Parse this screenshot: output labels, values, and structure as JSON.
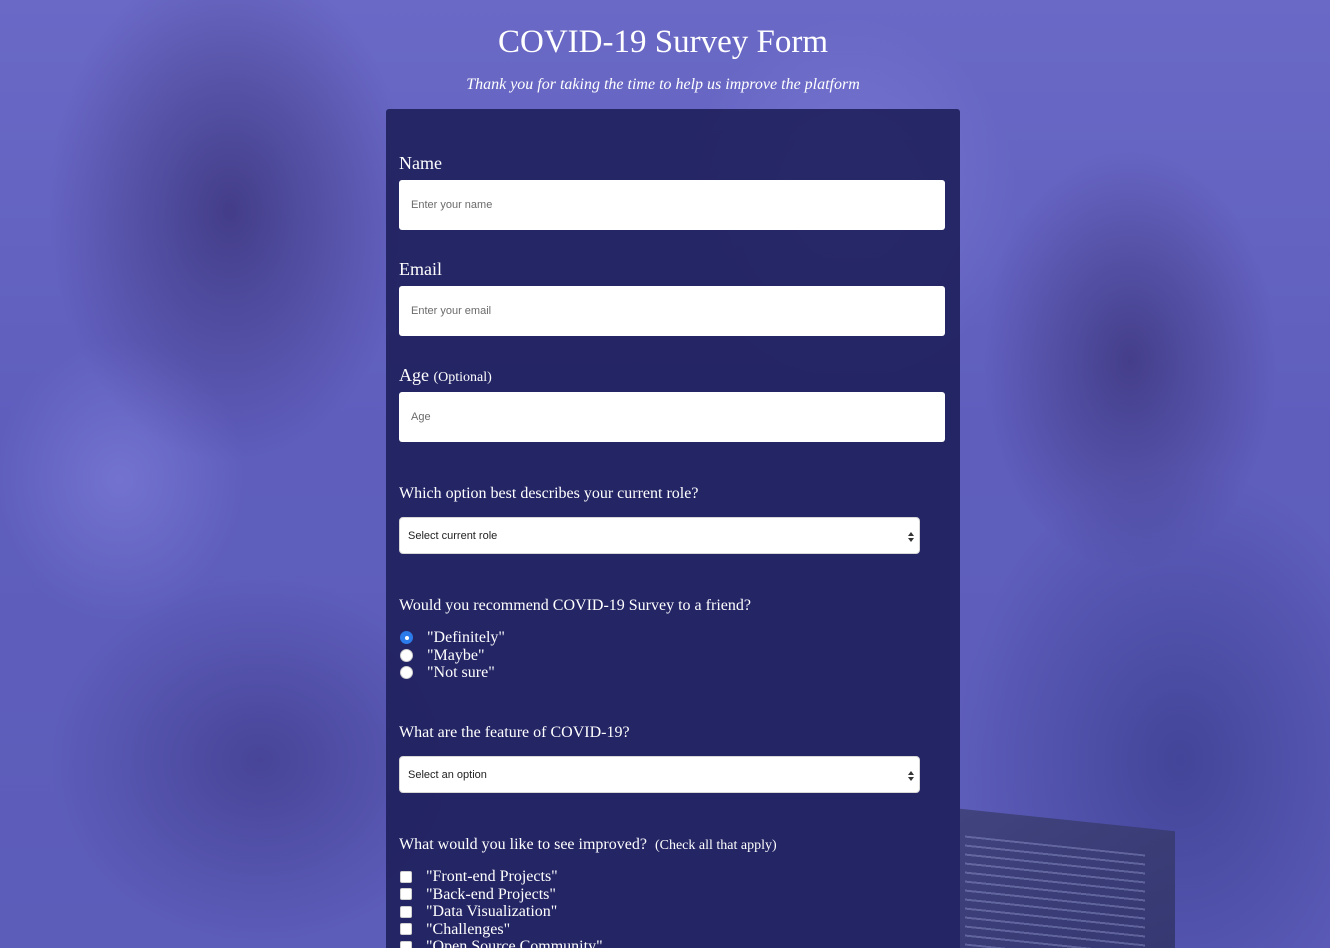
{
  "header": {
    "title": "COVID-19 Survey Form",
    "subtitle": "Thank you for taking the time to help us improve the platform"
  },
  "form": {
    "name": {
      "label": "Name",
      "placeholder": "Enter your name",
      "value": ""
    },
    "email": {
      "label": "Email",
      "placeholder": "Enter your email",
      "value": ""
    },
    "age": {
      "label": "Age",
      "label_note": "(Optional)",
      "placeholder": "Age",
      "value": ""
    },
    "role": {
      "question": "Which option best describes your current role?",
      "selected": "Select current role"
    },
    "recommend": {
      "question": "Would you recommend COVID-19 Survey to a friend?",
      "options": [
        "\"Definitely\"",
        "\"Maybe\"",
        "\"Not sure\""
      ],
      "selected_index": 0
    },
    "feature": {
      "question": "What are the feature of COVID-19?",
      "selected": "Select an option"
    },
    "improve": {
      "question": "What would you like to see improved?",
      "question_note": "(Check all that apply)",
      "options": [
        "\"Front-end Projects\"",
        "\"Back-end Projects\"",
        "\"Data Visualization\"",
        "\"Challenges\"",
        "\"Open Source Community\""
      ]
    }
  },
  "colors": {
    "card_background": "#1b1c56",
    "page_background": "#5f5ebd",
    "radio_selected": "#2c7bea",
    "text": "#ffffff"
  }
}
